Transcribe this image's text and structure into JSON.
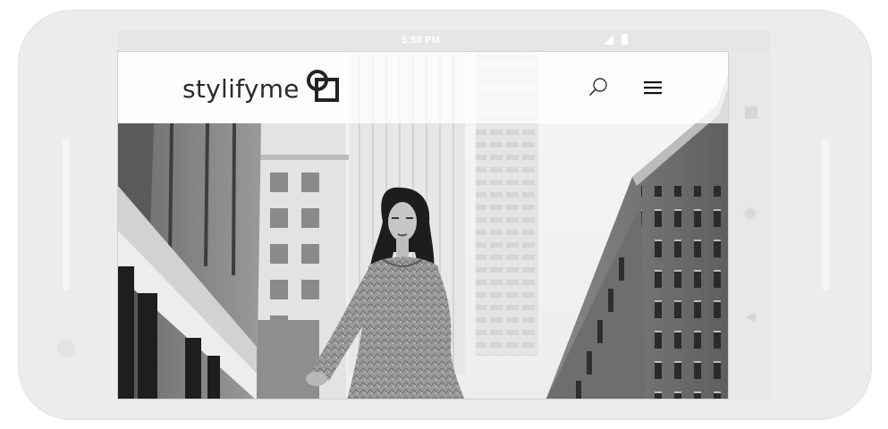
{
  "device": {
    "status_bar": {
      "time": "5:59 PM",
      "icons": [
        "signal-icon",
        "battery-icon"
      ]
    },
    "nav_buttons": [
      "recent-apps-icon",
      "home-icon",
      "back-icon"
    ]
  },
  "site": {
    "logo": {
      "text": "stylifyme",
      "mark_icon": "stylifyme-logo-mark-icon"
    },
    "header": {
      "search_icon": "search-icon",
      "menu_icon": "hamburger-menu-icon"
    },
    "hero": {
      "image": "black-and-white photo of woman in lace dress on city street between brick buildings"
    }
  },
  "colors": {
    "frame": "#ececec",
    "header_bg": "#ffffff",
    "logo_text": "#2b2b2b",
    "icon": "#222222"
  }
}
